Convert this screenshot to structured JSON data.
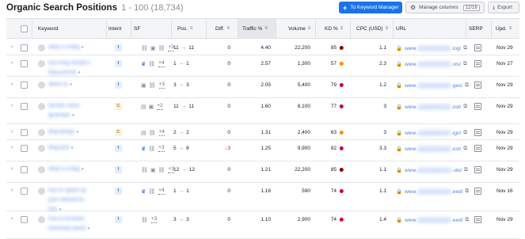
{
  "header": {
    "title": "Organic Search Positions",
    "range": "1 - 100 (18,734)",
    "to_keyword_manager": "To Keyword Manager",
    "manage_columns": "Manage columns",
    "columns_count": "12/16",
    "export": "Export"
  },
  "colors": {
    "primary": "#1a73e8",
    "link": "#4d84e4",
    "kd_hard": "#d1002f",
    "kd_medium": "#ff8c00",
    "kd_very_hard": "#8b0000",
    "negative": "#d1002f"
  },
  "columns": [
    "Keyword",
    "Intent",
    "SF",
    "Pos.",
    "Diff.",
    "Traffic %",
    "Volume",
    "KD %",
    "CPC (USD)",
    "URL",
    "SERP",
    "Upd."
  ],
  "rows": [
    {
      "keyword": "what is a blog",
      "intent": "I",
      "sf_icons": [
        "link-icon",
        "image-icon",
        "link-icon"
      ],
      "sf_more": "+3",
      "pos_from": "11",
      "pos_to": "11",
      "diff": "0",
      "traffic": "4.40",
      "volume": "22,200",
      "kd": "85",
      "kd_color": "#8b0000",
      "cpc": "1.1",
      "url_prefix": "www.",
      "url_suffix": ".log/",
      "upd": "Nov 29"
    },
    {
      "keyword": "how long should a blog post be",
      "intent": "I",
      "sf_icons": [
        "crown-icon",
        "link-icon"
      ],
      "sf_more": "+4",
      "pos_from": "1",
      "pos_to": "1",
      "diff": "0",
      "traffic": "2.57",
      "volume": "1,300",
      "kd": "57",
      "kd_color": "#ff8c00",
      "cpc": "2.3",
      "url_prefix": "www.",
      "url_suffix": ".sts/",
      "upd": "Nov 27"
    },
    {
      "keyword": "about us",
      "intent": "I",
      "sf_icons": [
        "image-icon",
        "link-icon"
      ],
      "sf_more": "+3",
      "pos_from": "3",
      "pos_to": "3",
      "diff": "0",
      "traffic": "2.05",
      "volume": "5,400",
      "kd": "79",
      "kd_color": "#d1002f",
      "cpc": "1.2",
      "url_prefix": "www.",
      "url_suffix": ".ges/",
      "upd": "Nov 29"
    },
    {
      "keyword": "domain name generator",
      "intent": "C",
      "sf_icons": [
        "doc-icon",
        "image-icon"
      ],
      "sf_more": "+2",
      "pos_from": "11",
      "pos_to": "11",
      "diff": "0",
      "traffic": "1.60",
      "volume": "8,100",
      "kd": "77",
      "kd_color": "#d1002f",
      "cpc": "3",
      "url_prefix": "www.",
      "url_suffix": ".ool/",
      "upd": "Nov 29"
    },
    {
      "keyword": "blog design",
      "intent": "C",
      "sf_icons": [
        "doc-icon",
        "link-icon"
      ],
      "sf_more": "+4",
      "pos_from": "2",
      "pos_to": "2",
      "diff": "0",
      "traffic": "1.31",
      "volume": "2,400",
      "kd": "63",
      "kd_color": "#ff8c00",
      "cpc": "3",
      "url_prefix": "www.",
      "url_suffix": ".ign/",
      "upd": "Nov 29"
    },
    {
      "keyword": "blog post",
      "intent": "I",
      "sf_icons": [
        "crown-icon",
        "link-icon"
      ],
      "sf_more": "+3",
      "pos_from": "5",
      "pos_to": "8",
      "diff": "3",
      "diff_negative": true,
      "traffic": "1.25",
      "volume": "9,900",
      "kd": "82",
      "kd_color": "#d1002f",
      "cpc": "3.3",
      "url_prefix": "www.",
      "url_suffix": ".ost/",
      "upd": "Nov 29"
    },
    {
      "keyword": "what is a blog",
      "intent": "I",
      "sf_icons": [
        "link-icon",
        "image-icon",
        "link-icon"
      ],
      "sf_more": "+3",
      "pos_from": "12",
      "pos_to": "12",
      "diff": "0",
      "traffic": "1.21",
      "volume": "22,200",
      "kd": "85",
      "kd_color": "#8b0000",
      "cpc": "1.1",
      "url_prefix": "www.",
      "url_suffix": ".-do/",
      "upd": "Nov 29"
    },
    {
      "keyword": "how to speed up your internet for free",
      "intent": "I",
      "sf_icons": [
        "crown-icon",
        "link-icon"
      ],
      "sf_more": "+4",
      "pos_from": "1",
      "pos_to": "1",
      "diff": "0",
      "traffic": "1.16",
      "volume": "590",
      "kd": "74",
      "kd_color": "#d1002f",
      "cpc": "1.1",
      "url_prefix": "www.",
      "url_suffix": ".eed/",
      "upd": "Nov 16"
    },
    {
      "keyword": "how to increase download speed",
      "intent": "I",
      "sf_icons": [
        "link-icon"
      ],
      "sf_more": "+3",
      "pos_from": "3",
      "pos_to": "3",
      "diff": "0",
      "traffic": "1.10",
      "volume": "2,900",
      "kd": "74",
      "kd_color": "#d1002f",
      "cpc": "1.4",
      "url_prefix": "www.",
      "url_suffix": ".eed/",
      "upd": "Nov 29"
    }
  ]
}
